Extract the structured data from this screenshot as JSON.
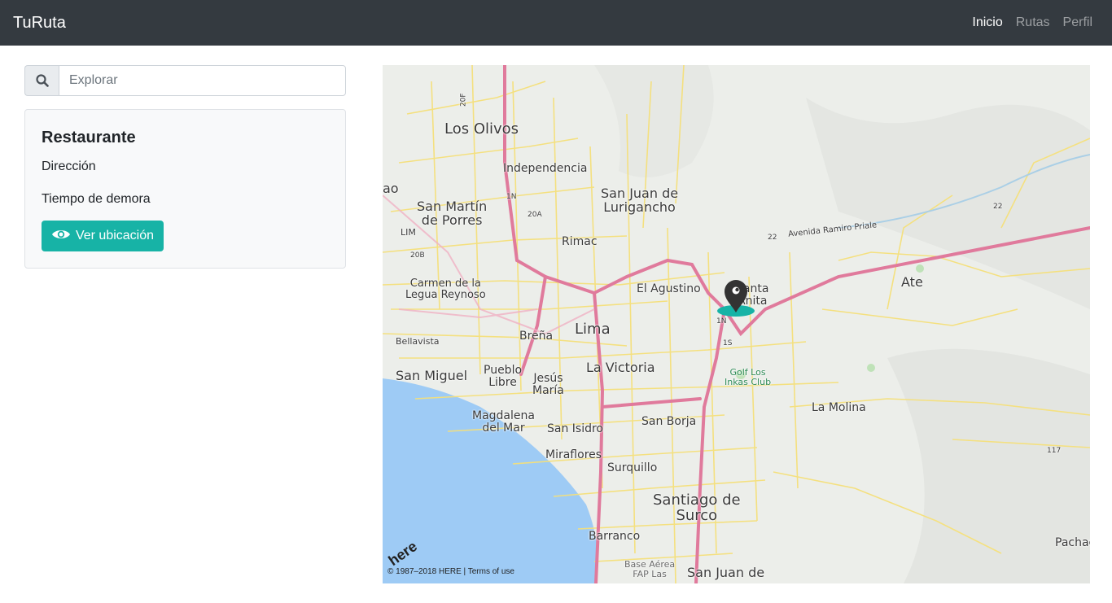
{
  "navbar": {
    "brand": "TuRuta",
    "links": [
      "Inicio",
      "Rutas",
      "Perfil"
    ]
  },
  "search": {
    "placeholder": "Explorar",
    "icon": "search-icon"
  },
  "card": {
    "title": "Restaurante",
    "address_label": "Dirección",
    "delay_label": "Tiempo de demora",
    "button_label": "Ver ubicación",
    "button_icon": "eye-icon",
    "button_color": "#17b3a6"
  },
  "map": {
    "labels": {
      "los_olivos": "Los Olivos",
      "independencia": "Independencia",
      "san_juan_lurigancho": "San Juan de\nLurigancho",
      "san_martin": "San Martín\nde Porres",
      "rimac": "Rimac",
      "callao_frag": "ao",
      "lim": "LIM",
      "carmen": "Carmen de la\nLegua Reynoso",
      "el_agustino": "El Agustino",
      "santa_anita": "Santa\nAnita",
      "ate": "Ate",
      "lima": "Lima",
      "brena": "Breña",
      "bellavista": "Bellavista",
      "la_victoria": "La Victoria",
      "san_miguel": "San Miguel",
      "pueblo_libre": "Pueblo\nLibre",
      "jesus_maria": "Jesús\nMaría",
      "golf": "Golf Los\nInkas Club",
      "la_molina": "La Molina",
      "magdalena": "Magdalena\ndel Mar",
      "san_isidro": "San Isidro",
      "san_borja": "San Borja",
      "miraflores": "Miraflores",
      "surquillo": "Surquillo",
      "santiago_surco": "Santiago de\nSurco",
      "barranco": "Barranco",
      "base_aerea": "Base Aérea\nFAP Las",
      "san_juan_mira": "San Juan de",
      "pachac": "Pachac",
      "avenida": "Avenida Ramiro Priale",
      "shield_20f": "20F",
      "shield_1n_a": "1N",
      "shield_20a": "20A",
      "shield_20b": "20B",
      "shield_22a": "22",
      "shield_22b": "22",
      "shield_1n_b": "1N",
      "shield_1s": "1S",
      "shield_117": "117"
    },
    "copyright": "© 1987–2018 HERE | Terms of use",
    "logo": "here",
    "marker_icon": "map-pin-icon",
    "sea_color": "#9ecbf5",
    "road_color": "#f5e07a",
    "highway_color": "#e07a9c"
  }
}
